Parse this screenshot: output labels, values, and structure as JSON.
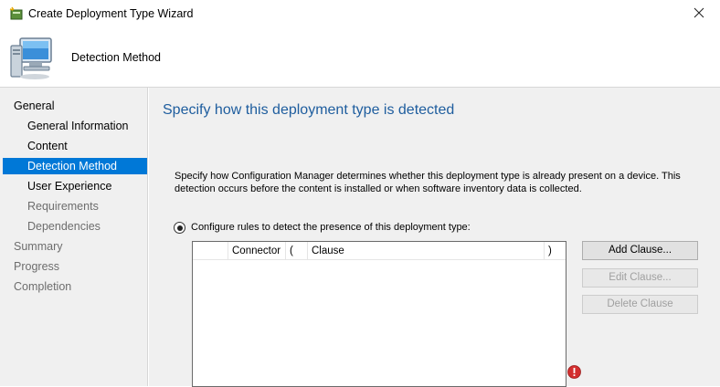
{
  "window": {
    "title": "Create Deployment Type Wizard",
    "close_glyph": "✕"
  },
  "header": {
    "title": "Detection Method",
    "icon": "computer-icon"
  },
  "sidebar": {
    "items": [
      {
        "label": "General",
        "level": "top",
        "state": "normal"
      },
      {
        "label": "General Information",
        "level": "sub",
        "state": "normal"
      },
      {
        "label": "Content",
        "level": "sub",
        "state": "normal"
      },
      {
        "label": "Detection Method",
        "level": "sub",
        "state": "selected"
      },
      {
        "label": "User Experience",
        "level": "sub",
        "state": "normal"
      },
      {
        "label": "Requirements",
        "level": "sub",
        "state": "disabled"
      },
      {
        "label": "Dependencies",
        "level": "sub",
        "state": "disabled"
      },
      {
        "label": "Summary",
        "level": "top",
        "state": "disabled"
      },
      {
        "label": "Progress",
        "level": "top",
        "state": "disabled"
      },
      {
        "label": "Completion",
        "level": "top",
        "state": "disabled"
      }
    ]
  },
  "main": {
    "title": "Specify how this deployment type is detected",
    "description": "Specify how Configuration Manager determines whether this deployment type is already present on a device. This detection occurs before the content is installed or when software inventory data is collected.",
    "radio_label": "Configure rules to detect the presence of this deployment type:",
    "radio_selected": true,
    "grid": {
      "columns": [
        "",
        "Connector",
        "(",
        "Clause",
        ")"
      ],
      "rows": []
    },
    "buttons": {
      "add_clause": "Add Clause...",
      "edit_clause": "Edit Clause...",
      "delete_clause": "Delete Clause"
    },
    "error_icon": "error-icon"
  },
  "colors": {
    "accent": "#0078d7",
    "title_blue": "#1e5d9e",
    "panel_bg": "#f0f0f0",
    "error_red": "#d32f2f"
  }
}
